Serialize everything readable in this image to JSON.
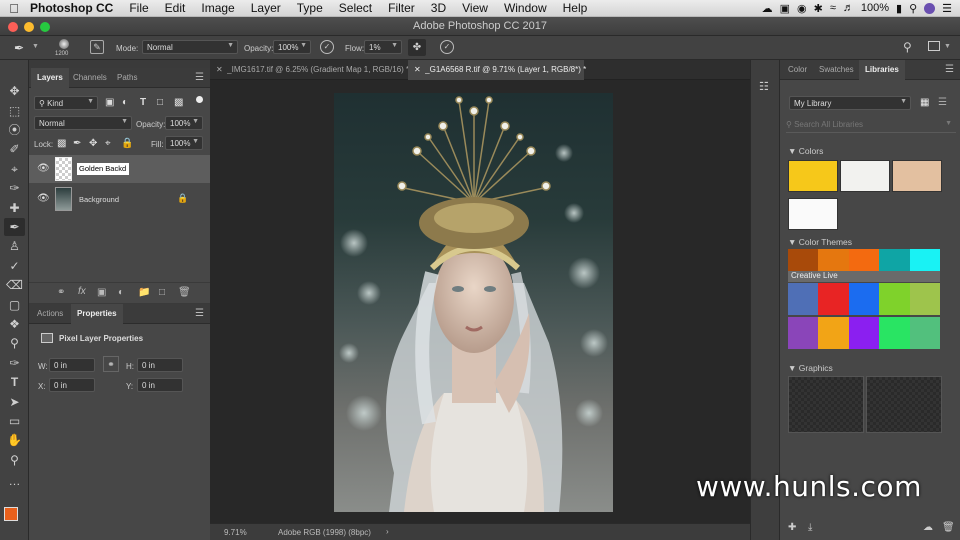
{
  "menubar": {
    "app": "Photoshop CC",
    "items": [
      "File",
      "Edit",
      "Image",
      "Layer",
      "Type",
      "Select",
      "Filter",
      "3D",
      "View",
      "Window",
      "Help"
    ],
    "battery": "100%"
  },
  "window_title": "Adobe Photoshop CC 2017",
  "options": {
    "brush_size": "1200",
    "mode_label": "Mode:",
    "mode_value": "Normal",
    "opacity_label": "Opacity:",
    "opacity_value": "100%",
    "flow_label": "Flow:",
    "flow_value": "1%"
  },
  "layers_panel": {
    "tabs": [
      "Layers",
      "Channels",
      "Paths"
    ],
    "filter_kind": "Kind",
    "blend_mode": "Normal",
    "opacity_label": "Opacity:",
    "opacity_value": "100%",
    "lock_label": "Lock:",
    "fill_label": "Fill:",
    "fill_value": "100%",
    "layers": [
      {
        "name": "Golden Backd"
      },
      {
        "name": "Background"
      }
    ]
  },
  "properties_panel": {
    "tabs": [
      "Actions",
      "Properties"
    ],
    "heading": "Pixel Layer Properties",
    "w_label": "W:",
    "w_value": "0 in",
    "h_label": "H:",
    "h_value": "0 in",
    "x_label": "X:",
    "x_value": "0 in",
    "y_label": "Y:",
    "y_value": "0 in"
  },
  "document_tabs": [
    {
      "label": "_IMG1617.tif @ 6.25% (Gradient Map 1, RGB/16) *"
    },
    {
      "label": "_G1A6568 R.tif @ 9.71% (Layer 1, RGB/8*) *"
    }
  ],
  "status": {
    "zoom": "9.71%",
    "profile": "Adobe RGB (1998) (8bpc)"
  },
  "libraries_panel": {
    "tabs": [
      "Color",
      "Swatches",
      "Libraries"
    ],
    "library_name": "My Library",
    "search_placeholder": "Search All Libraries",
    "colors_label": "Colors",
    "colors": [
      "#f6c81a",
      "#f2f2ef",
      "#e3c0a0",
      "#fafafa"
    ],
    "themes_label": "Color Themes",
    "theme_name": "Creative Live",
    "theme_rows": [
      [
        "#a84a0a",
        "#e5770f",
        "#f36a10",
        "#0fa5a5",
        "#19f2f4"
      ],
      [
        "#4f6fb6",
        "#e82424",
        "#1b6cf0",
        "#7fd22b",
        "#9ec44c"
      ],
      [
        "#8a45b9",
        "#f2a416",
        "#8b1ff0",
        "#29e463",
        "#52c07d"
      ]
    ],
    "graphics_label": "Graphics"
  },
  "watermark": "www.hunls.com",
  "colors": {
    "foreground": "#e8601c",
    "background": "#f08a33"
  }
}
